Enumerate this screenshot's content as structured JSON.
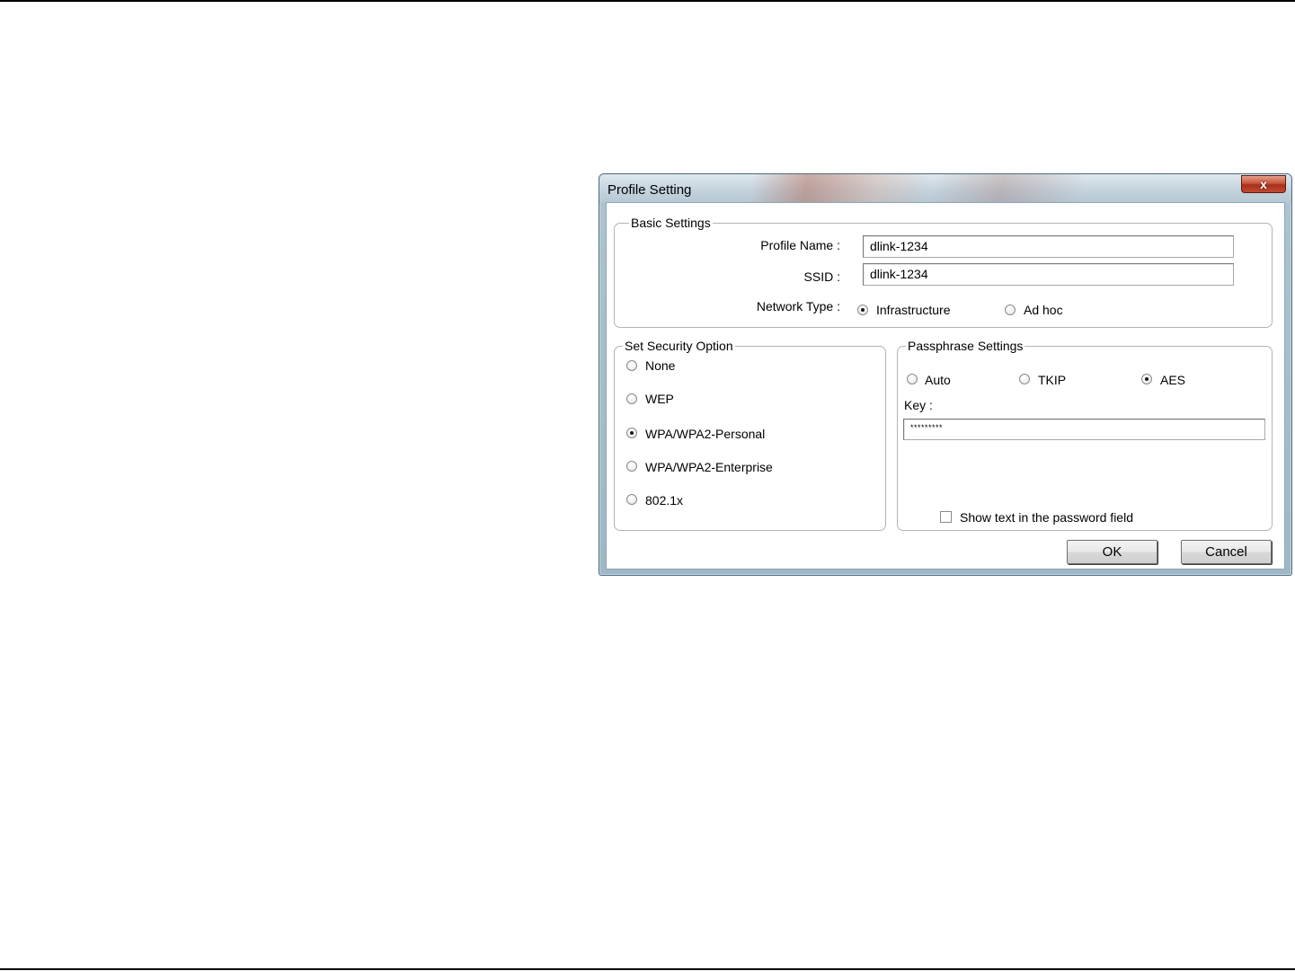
{
  "dialog": {
    "title": "Profile Setting",
    "close_label": "x"
  },
  "basic_settings": {
    "legend": "Basic Settings",
    "profile_name_label": "Profile Name :",
    "profile_name_value": "dlink-1234",
    "ssid_label": "SSID :",
    "ssid_value": "dlink-1234",
    "network_type_label": "Network Type :",
    "network_type_options": [
      {
        "label": "Infrastructure",
        "selected": true
      },
      {
        "label": "Ad hoc",
        "selected": false
      }
    ]
  },
  "security": {
    "legend": "Set Security Option",
    "options": [
      {
        "label": "None",
        "selected": false
      },
      {
        "label": "WEP",
        "selected": false
      },
      {
        "label": "WPA/WPA2-Personal",
        "selected": true
      },
      {
        "label": "WPA/WPA2-Enterprise",
        "selected": false
      },
      {
        "label": "802.1x",
        "selected": false
      }
    ]
  },
  "passphrase": {
    "legend": "Passphrase Settings",
    "cipher_options": [
      {
        "label": "Auto",
        "selected": false
      },
      {
        "label": "TKIP",
        "selected": false
      },
      {
        "label": "AES",
        "selected": true
      }
    ],
    "key_label": "Key :",
    "key_value": "*********",
    "show_text_label": "Show text in the password field",
    "show_text_checked": false
  },
  "buttons": {
    "ok": "OK",
    "cancel": "Cancel"
  }
}
